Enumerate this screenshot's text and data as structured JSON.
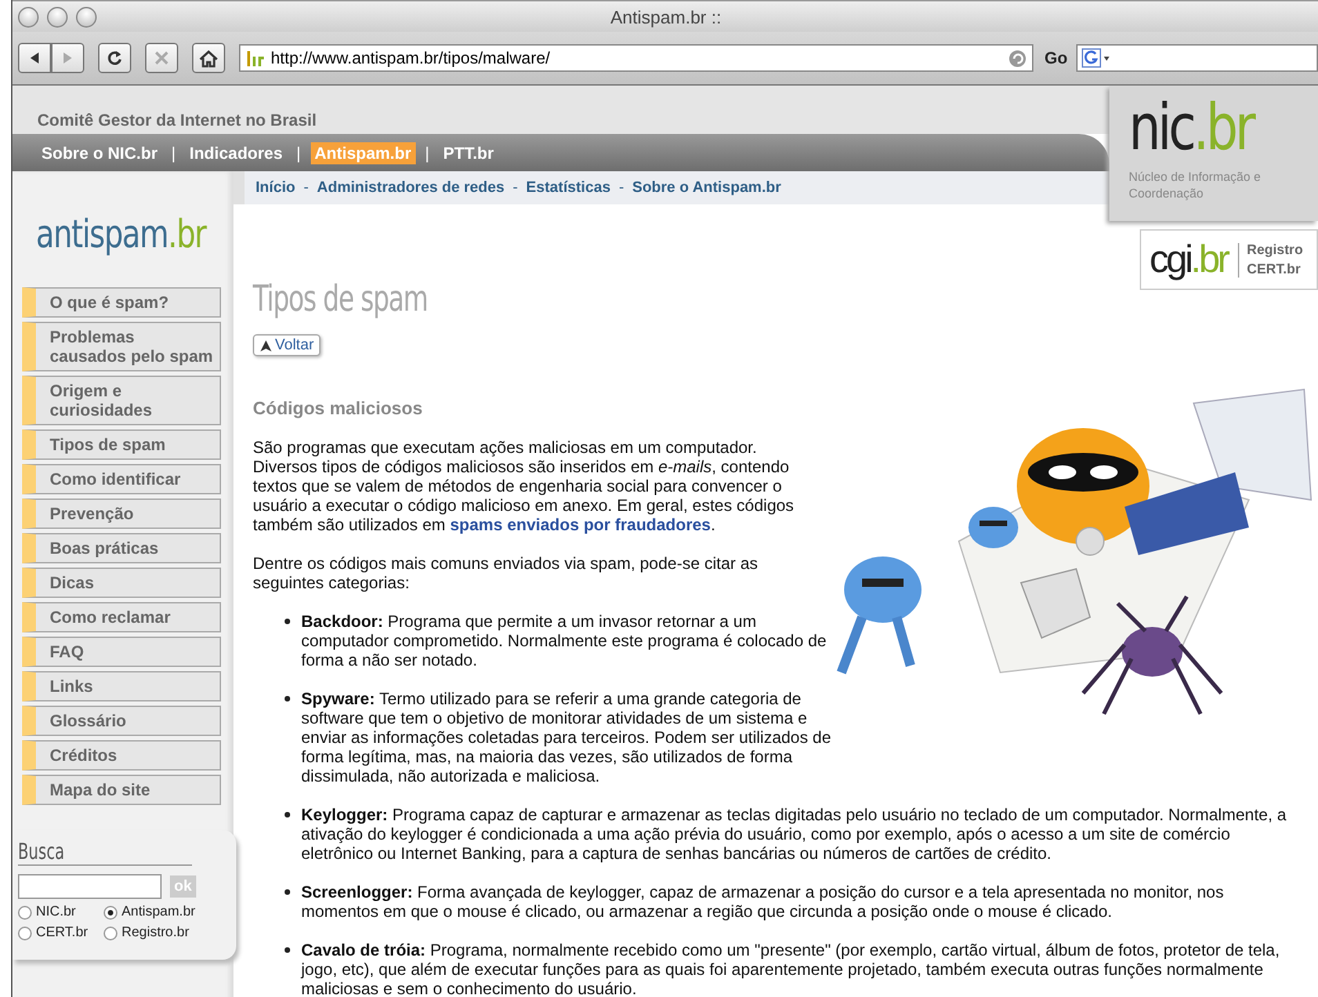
{
  "browser": {
    "title": "Antispam.br ::",
    "nav_buttons": [
      {
        "kind": "back",
        "disabled": false
      },
      {
        "kind": "forward",
        "disabled": true
      },
      {
        "kind": "reload",
        "disabled": false
      },
      {
        "kind": "stop",
        "disabled": true
      },
      {
        "kind": "home",
        "disabled": false
      }
    ],
    "url": "http://www.antispam.br/tipos/malware/",
    "go_label": "Go"
  },
  "header": {
    "org": "Comitê Gestor da Internet no Brasil",
    "separator": "|",
    "nav": [
      {
        "label": "Sobre o NIC.br",
        "selected": false
      },
      {
        "label": "Indicadores",
        "selected": false
      },
      {
        "label": "Antispam.br",
        "selected": true
      },
      {
        "label": "PTT.br",
        "selected": false
      }
    ]
  },
  "nic_logo": {
    "name": "nic",
    "suffix": ".br",
    "subtitle": "Núcleo de Informação e Coordenação"
  },
  "cgi_logo": {
    "name": "cgi",
    "suffix": ".br",
    "links": [
      "Registro",
      "CERT.br"
    ]
  },
  "breadcrumbs": {
    "separator": "-",
    "items": [
      "Início",
      "Administradores de redes",
      "Estatísticas",
      "Sobre o Antispam.br"
    ]
  },
  "sidebar": {
    "logo": {
      "name": "antispam",
      "suffix": ".br"
    },
    "menu": [
      {
        "lines": [
          "O que é spam?"
        ]
      },
      {
        "lines": [
          "Problemas",
          "causados pelo spam"
        ]
      },
      {
        "lines": [
          "Origem e",
          "curiosidades"
        ]
      },
      {
        "lines": [
          "Tipos de spam"
        ]
      },
      {
        "lines": [
          "Como identificar"
        ]
      },
      {
        "lines": [
          "Prevenção"
        ]
      },
      {
        "lines": [
          "Boas práticas"
        ]
      },
      {
        "lines": [
          "Dicas"
        ]
      },
      {
        "lines": [
          "Como reclamar"
        ]
      },
      {
        "lines": [
          "FAQ"
        ]
      },
      {
        "lines": [
          "Links"
        ]
      },
      {
        "lines": [
          "Glossário"
        ]
      },
      {
        "lines": [
          "Créditos"
        ]
      },
      {
        "lines": [
          "Mapa do site"
        ]
      }
    ],
    "search": {
      "title": "Busca",
      "button": "ok",
      "options": [
        {
          "label": "NIC.br",
          "selected": false
        },
        {
          "label": "Antispam.br",
          "selected": true
        },
        {
          "label": "CERT.br",
          "selected": false
        },
        {
          "label": "Registro.br",
          "selected": false
        }
      ]
    }
  },
  "content": {
    "title": "Tipos de spam",
    "back_button": "Voltar",
    "heading": "Códigos maliciosos",
    "intro": {
      "text": "São programas que executam ações maliciosas em um computador. Diversos tipos de códigos maliciosos são inseridos em *e-mails*, contendo textos que se valem de métodos de engenharia social para convencer o usuário a executar o código malicioso em anexo. Em geral, estes códigos também são utilizados em",
      "link": "spams enviados por fraudadores",
      "after": "."
    },
    "lead": "Dentre os códigos mais comuns enviados via spam, pode-se citar as seguintes categorias:",
    "items": [
      "**Backdoor:** Programa que permite a um invasor retornar a um computador comprometido. Normalmente este programa é colocado de forma a não ser notado.",
      "**Spyware:** Termo utilizado para se referir a uma grande categoria de software que tem o objetivo de monitorar atividades de um sistema e enviar as informações coletadas para terceiros. Podem ser utilizados de forma legítima, mas, na maioria das vezes, são utilizados de forma dissimulada, não autorizada e maliciosa.",
      "**Keylogger:** Programa capaz de capturar e armazenar as teclas digitadas pelo usuário no teclado de um computador. Normalmente, a ativação do keylogger é condicionada a uma ação prévia do usuário, como por exemplo, após o acesso a um site de comércio eletrônico ou Internet Banking, para a captura de senhas bancárias ou números de cartões de crédito.",
      "**Screenlogger:** Forma avançada de keylogger, capaz de armazenar a posição do cursor e a tela apresentada no monitor, nos momentos em que o mouse é clicado, ou armazenar a região que circunda a posição onde o mouse é clicado.",
      "**Cavalo de tróia:** Programa, normalmente recebido como um \"presente\" (por exemplo, cartão virtual, álbum de fotos, protetor de tela, jogo, etc), que além de executar funções para as quais foi aparentemente projetado, também executa outras funções normalmente maliciosas e sem o conhecimento do usuário."
    ]
  }
}
